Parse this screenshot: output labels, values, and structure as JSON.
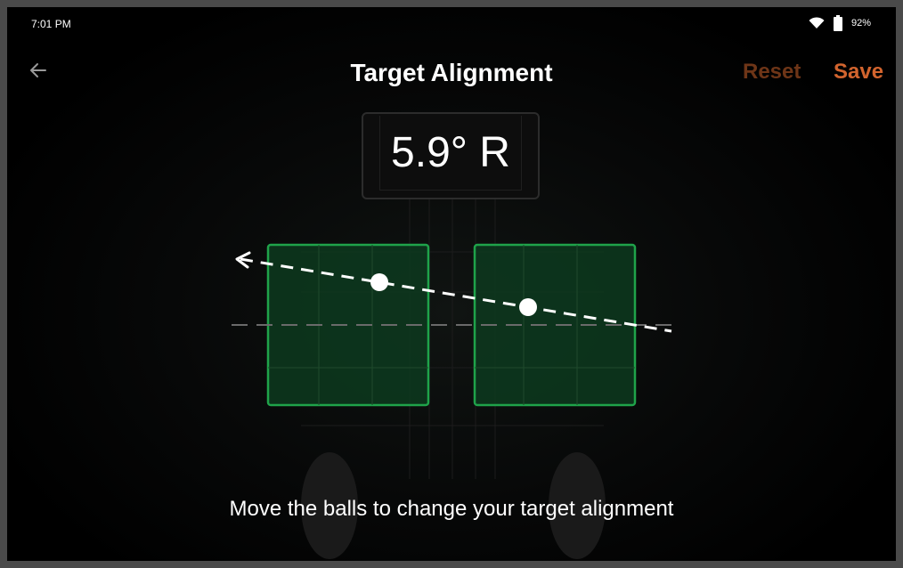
{
  "status_bar": {
    "time": "7:01 PM",
    "battery_percent": "92%",
    "wifi_icon": "wifi-icon",
    "battery_icon": "battery-icon"
  },
  "app_bar": {
    "back_icon": "arrow-left-icon",
    "title": "Target Alignment",
    "reset_label": "Reset",
    "save_label": "Save"
  },
  "alignment": {
    "readout": "5.9° R"
  },
  "instruction": "Move the balls to change your target alignment",
  "colors": {
    "accent": "#d2642e",
    "accent_disabled": "#6e3517",
    "target_box_border": "#1fa34a",
    "target_box_fill": "#0d3a1e"
  }
}
